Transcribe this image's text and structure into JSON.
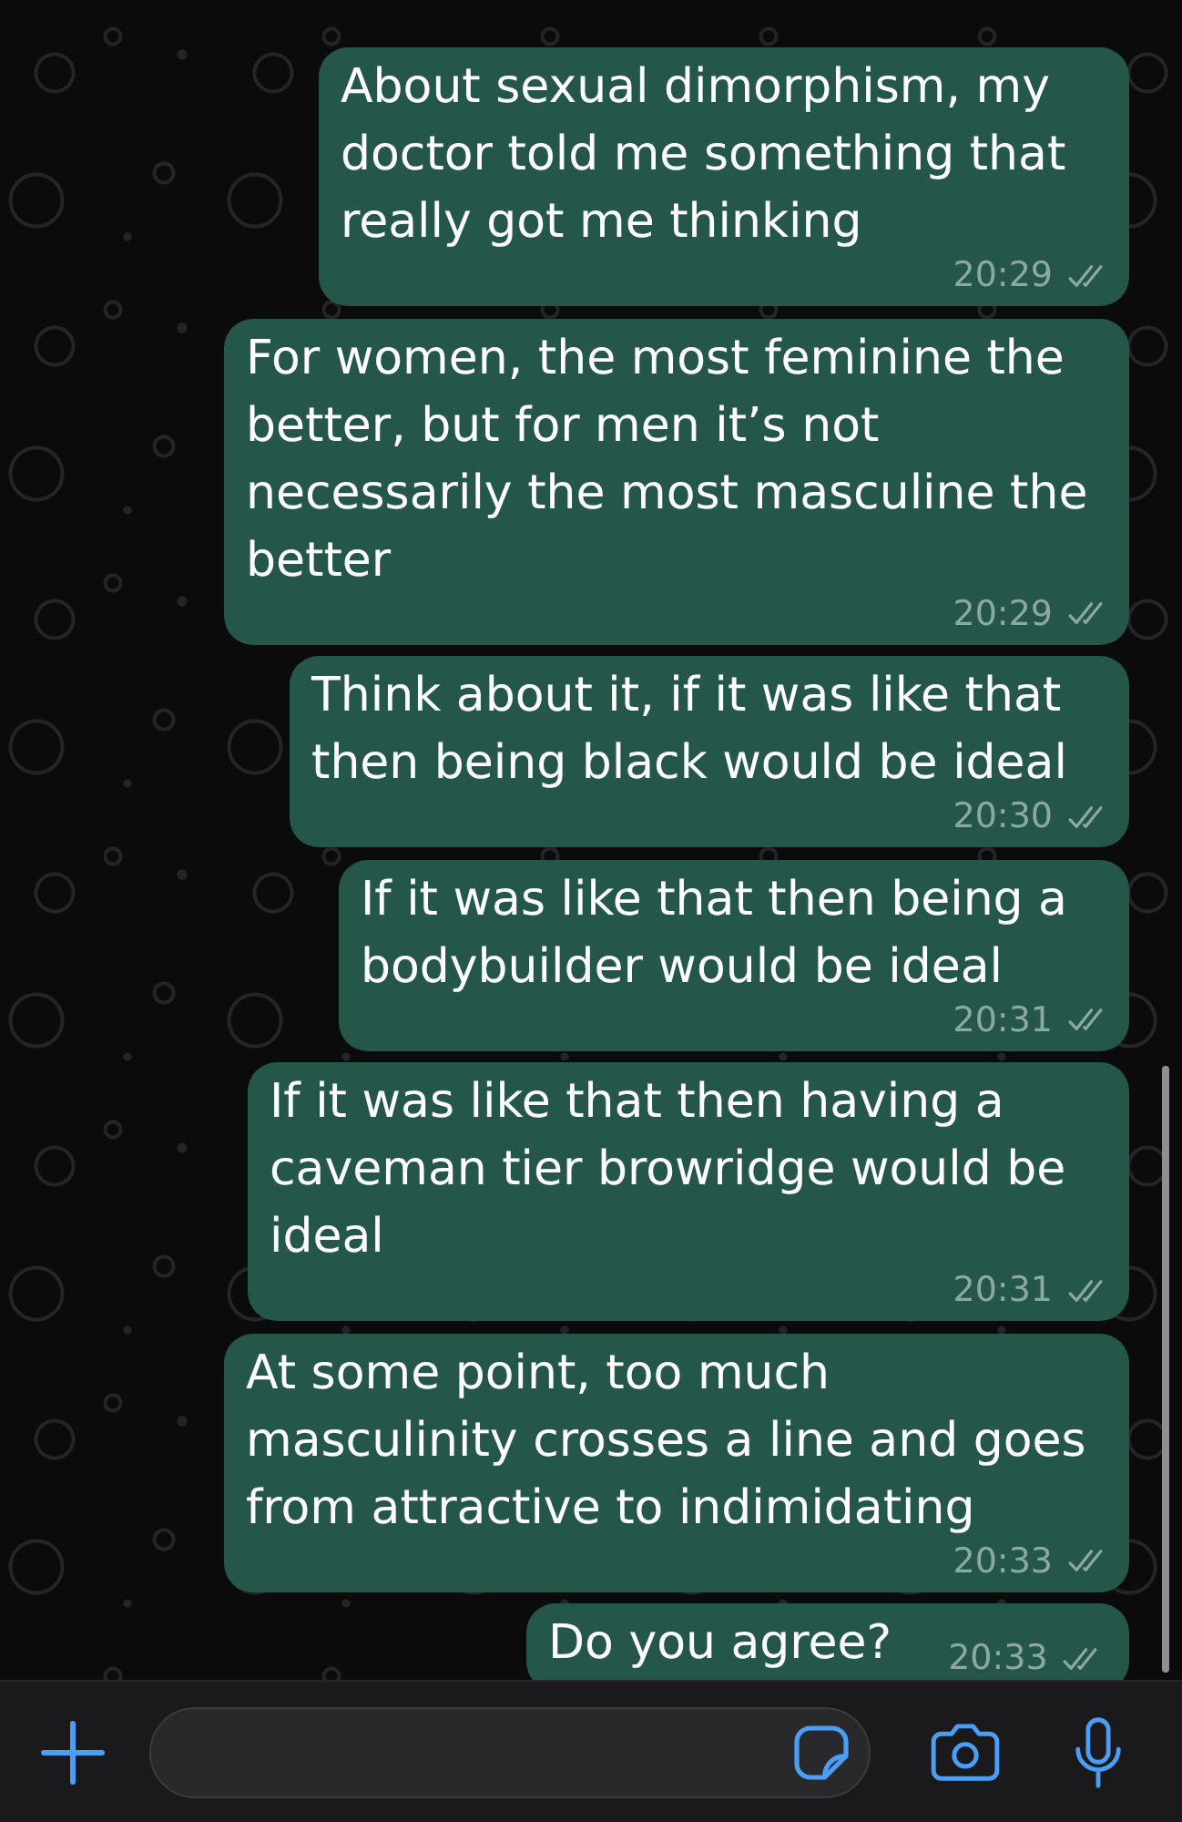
{
  "messages": [
    {
      "text": "About sexual dimorphism, my doctor told me something that really got me thinking",
      "time": "20:29",
      "delivered": true,
      "read": false
    },
    {
      "text": "For women, the most feminine the better, but for men it’s not necessarily the most masculine the better",
      "time": "20:29",
      "delivered": true,
      "read": false
    },
    {
      "text": "Think about it, if it was like that then being black would be ideal",
      "time": "20:30",
      "delivered": true,
      "read": false
    },
    {
      "text": "If it was like that then being a bodybuilder would be ideal",
      "time": "20:31",
      "delivered": true,
      "read": false
    },
    {
      "text": "If it was like that then having a caveman tier browridge would be ideal",
      "time": "20:31",
      "delivered": true,
      "read": false
    },
    {
      "text": "At some point, too much masculinity crosses a line and goes from attractive to indimidating",
      "time": "20:33",
      "delivered": true,
      "read": false
    },
    {
      "text": "Do you agree?",
      "time": "20:33",
      "delivered": true,
      "read": false
    }
  ]
}
